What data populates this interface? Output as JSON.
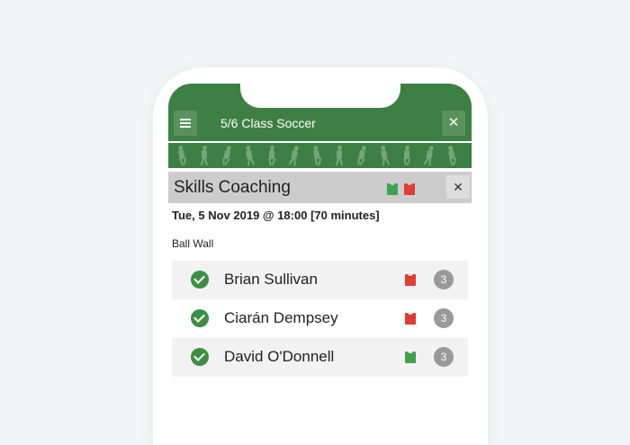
{
  "header": {
    "title": "5/6 Class Soccer",
    "menu_icon": "hamburger-menu-icon",
    "close_icon": "close-icon",
    "close_glyph": "✕"
  },
  "session": {
    "title": "Skills Coaching",
    "bib_colors": [
      "#3fa34d",
      "#e03c31"
    ],
    "close_glyph": "✕",
    "date": "Tue, 5 Nov 2019 @ 18:00 [70 minutes]",
    "activity": "Ball Wall"
  },
  "players": [
    {
      "name": "Brian Sullivan",
      "bib_color": "#e03c31",
      "count": "3",
      "checked": true
    },
    {
      "name": "Ciarán Dempsey",
      "bib_color": "#e03c31",
      "count": "3",
      "checked": true
    },
    {
      "name": "David O'Donnell",
      "bib_color": "#3fa34d",
      "count": "3",
      "checked": true
    }
  ],
  "colors": {
    "brand_green": "#3e7f45",
    "check_green": "#3e8f46",
    "count_gray": "#999999"
  }
}
